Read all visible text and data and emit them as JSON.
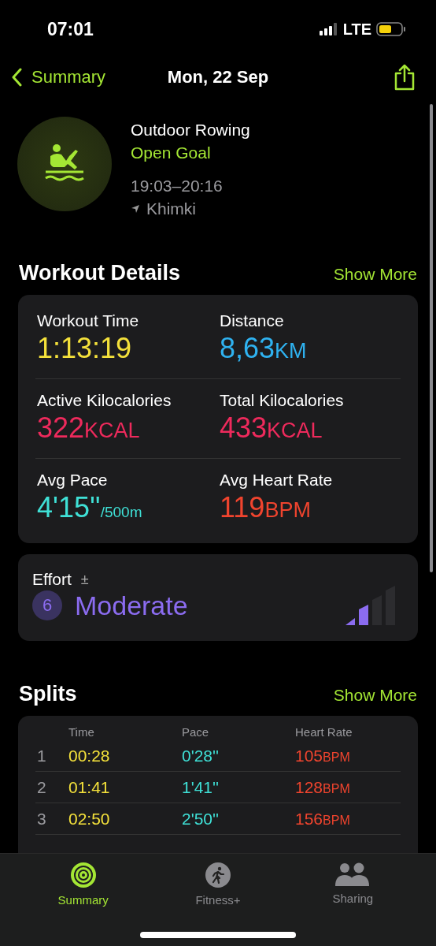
{
  "status_bar": {
    "time": "07:01",
    "network": "LTE"
  },
  "nav": {
    "back": "Summary",
    "title": "Mon, 22 Sep"
  },
  "workout": {
    "name": "Outdoor Rowing",
    "goal": "Open Goal",
    "time_range": "19:03–20:16",
    "location": "Khimki"
  },
  "details": {
    "title": "Workout Details",
    "action": "Show More",
    "metrics": [
      {
        "label": "Workout Time",
        "value": "1:13:19",
        "kind": "plain",
        "color": "#f4e13b"
      },
      {
        "label": "Distance",
        "value": "8,63",
        "unit": "KM",
        "kind": "unit",
        "color": "#2fb2f0"
      },
      {
        "label": "Active Kilocalories",
        "value": "322",
        "unit": "KCAL",
        "kind": "unit",
        "color": "#ee2a5c"
      },
      {
        "label": "Total Kilocalories",
        "value": "433",
        "unit": "KCAL",
        "kind": "unit",
        "color": "#ee2a5c"
      },
      {
        "label": "Avg Pace",
        "value": "4'15''",
        "unit": "/500m",
        "kind": "per",
        "color": "#3fe0d6"
      },
      {
        "label": "Avg Heart Rate",
        "value": "119",
        "unit": "BPM",
        "kind": "unit",
        "color": "#f0442e"
      }
    ]
  },
  "effort": {
    "label": "Effort",
    "adjust": "±",
    "score": "6",
    "rating": "Moderate",
    "level": 0.5
  },
  "splits": {
    "title": "Splits",
    "action": "Show More",
    "columns": [
      "Time",
      "Pace",
      "Heart Rate"
    ],
    "rows": [
      {
        "index": "1",
        "time": "00:28",
        "pace": "0'28''",
        "heart_rate": "105",
        "unit": "BPM"
      },
      {
        "index": "2",
        "time": "01:41",
        "pace": "1'41''",
        "heart_rate": "128",
        "unit": "BPM"
      },
      {
        "index": "3",
        "time": "02:50",
        "pace": "2'50''",
        "heart_rate": "156",
        "unit": "BPM"
      }
    ]
  },
  "tabs": [
    {
      "label": "Summary",
      "selected": true,
      "kind": "rings"
    },
    {
      "label": "Fitness+",
      "selected": false,
      "kind": "runner"
    },
    {
      "label": "Sharing",
      "selected": false,
      "kind": "people"
    }
  ]
}
